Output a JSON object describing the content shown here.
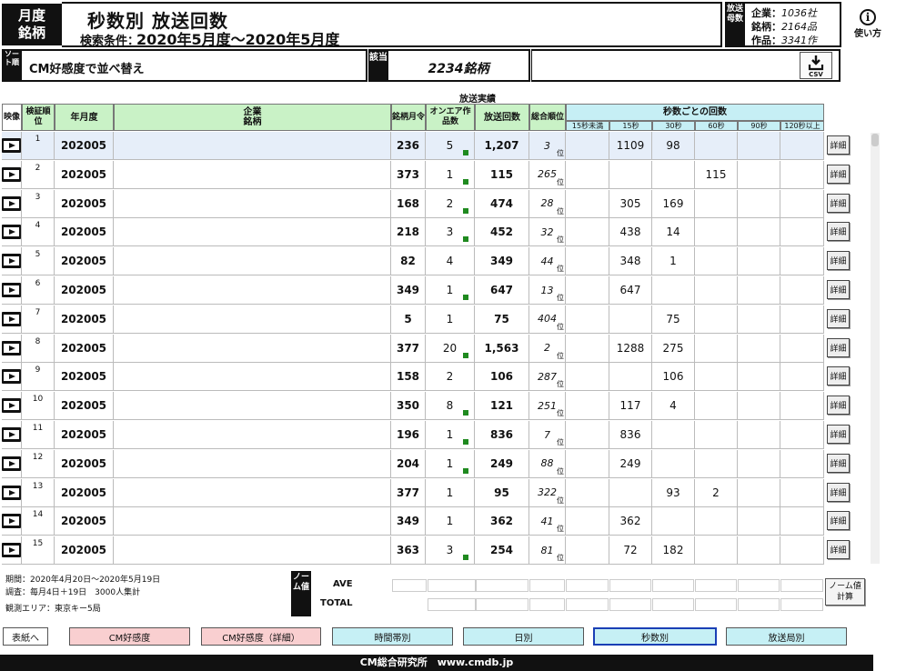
{
  "header": {
    "badge_line1": "月度",
    "badge_line2": "銘柄",
    "title": "秒数別 放送回数",
    "condition_label": "検索条件：",
    "condition_value": "2020年5月度〜2020年5月度",
    "vertical_label": "放送母数",
    "stats": [
      {
        "key": "企業：",
        "value": "1036社"
      },
      {
        "key": "銘柄：",
        "value": "2164品"
      },
      {
        "key": "作品：",
        "value": "3341作"
      }
    ],
    "help_label": "使い方",
    "help_glyph": "i"
  },
  "sort_bar": {
    "label": "ソート順",
    "value": "CM好感度で並べ替え",
    "count_label": "該当",
    "count_value": "2234銘柄",
    "csv_label": "CSV"
  },
  "table": {
    "group_label": "放送実績",
    "headers": {
      "video": "映像",
      "rank": "検証順位",
      "month": "年月度",
      "company": "企業\n銘柄",
      "brand_months": "銘柄月令",
      "onair": "オンエア作品数",
      "broadcasts": "放送回数",
      "overall_rank": "総合順位",
      "seconds_group": "秒数ごとの回数",
      "sec_cols": [
        "15秒未満",
        "15秒",
        "30秒",
        "60秒",
        "90秒",
        "120秒以上"
      ]
    },
    "detail_label": "詳細",
    "rank_suffix": "位",
    "rows": [
      {
        "rank": "1",
        "month": "202005",
        "company": "",
        "months": "236",
        "onair": "5",
        "onair_flag": true,
        "count": "1,207",
        "overall": "3",
        "sec": [
          "",
          "1109",
          "98",
          "",
          "",
          ""
        ]
      },
      {
        "rank": "2",
        "month": "202005",
        "company": "",
        "months": "373",
        "onair": "1",
        "onair_flag": true,
        "count": "115",
        "overall": "265",
        "sec": [
          "",
          "",
          "",
          "115",
          "",
          ""
        ]
      },
      {
        "rank": "3",
        "month": "202005",
        "company": "",
        "months": "168",
        "onair": "2",
        "onair_flag": true,
        "count": "474",
        "overall": "28",
        "sec": [
          "",
          "305",
          "169",
          "",
          "",
          ""
        ]
      },
      {
        "rank": "4",
        "month": "202005",
        "company": "",
        "months": "218",
        "onair": "3",
        "onair_flag": true,
        "count": "452",
        "overall": "32",
        "sec": [
          "",
          "438",
          "14",
          "",
          "",
          ""
        ]
      },
      {
        "rank": "5",
        "month": "202005",
        "company": "",
        "months": "82",
        "onair": "4",
        "onair_flag": false,
        "count": "349",
        "overall": "44",
        "sec": [
          "",
          "348",
          "1",
          "",
          "",
          ""
        ]
      },
      {
        "rank": "6",
        "month": "202005",
        "company": "",
        "months": "349",
        "onair": "1",
        "onair_flag": true,
        "count": "647",
        "overall": "13",
        "sec": [
          "",
          "647",
          "",
          "",
          "",
          ""
        ]
      },
      {
        "rank": "7",
        "month": "202005",
        "company": "",
        "months": "5",
        "onair": "1",
        "onair_flag": false,
        "count": "75",
        "overall": "404",
        "sec": [
          "",
          "",
          "75",
          "",
          "",
          ""
        ]
      },
      {
        "rank": "8",
        "month": "202005",
        "company": "",
        "months": "377",
        "onair": "20",
        "onair_flag": true,
        "count": "1,563",
        "overall": "2",
        "sec": [
          "",
          "1288",
          "275",
          "",
          "",
          ""
        ]
      },
      {
        "rank": "9",
        "month": "202005",
        "company": "",
        "months": "158",
        "onair": "2",
        "onair_flag": false,
        "count": "106",
        "overall": "287",
        "sec": [
          "",
          "",
          "106",
          "",
          "",
          ""
        ]
      },
      {
        "rank": "10",
        "month": "202005",
        "company": "",
        "months": "350",
        "onair": "8",
        "onair_flag": true,
        "count": "121",
        "overall": "251",
        "sec": [
          "",
          "117",
          "4",
          "",
          "",
          ""
        ]
      },
      {
        "rank": "11",
        "month": "202005",
        "company": "",
        "months": "196",
        "onair": "1",
        "onair_flag": true,
        "count": "836",
        "overall": "7",
        "sec": [
          "",
          "836",
          "",
          "",
          "",
          ""
        ]
      },
      {
        "rank": "12",
        "month": "202005",
        "company": "",
        "months": "204",
        "onair": "1",
        "onair_flag": true,
        "count": "249",
        "overall": "88",
        "sec": [
          "",
          "249",
          "",
          "",
          "",
          ""
        ]
      },
      {
        "rank": "13",
        "month": "202005",
        "company": "",
        "months": "377",
        "onair": "1",
        "onair_flag": false,
        "count": "95",
        "overall": "322",
        "sec": [
          "",
          "",
          "93",
          "2",
          "",
          ""
        ]
      },
      {
        "rank": "14",
        "month": "202005",
        "company": "",
        "months": "349",
        "onair": "1",
        "onair_flag": false,
        "count": "362",
        "overall": "41",
        "sec": [
          "",
          "362",
          "",
          "",
          "",
          ""
        ]
      },
      {
        "rank": "15",
        "month": "202005",
        "company": "",
        "months": "363",
        "onair": "3",
        "onair_flag": true,
        "count": "254",
        "overall": "81",
        "sec": [
          "",
          "72",
          "182",
          "",
          "",
          ""
        ]
      }
    ]
  },
  "footer": {
    "period": "期間：2020年4月20日〜2020年5月19日",
    "survey": "調査：毎月4日＋19日　3000人集計",
    "area": "観測エリア：東京キー5局",
    "norm_label": "ノーム値",
    "ave_label": "AVE",
    "total_label": "TOTAL",
    "calc_button": "ノーム値\n計算"
  },
  "nav": {
    "buttons": [
      {
        "label": "表紙へ",
        "style": "white"
      },
      {
        "label": "CM好感度",
        "style": "pink"
      },
      {
        "label": "CM好感度（詳細）",
        "style": "pink"
      },
      {
        "label": "時間帯別",
        "style": "lcyan"
      },
      {
        "label": "日別",
        "style": "lcyan"
      },
      {
        "label": "秒数別",
        "style": "lcyan",
        "selected": true
      },
      {
        "label": "放送局別",
        "style": "lcyan"
      }
    ],
    "brand": "CM総合研究所　www.cmdb.jp"
  },
  "colors": {
    "header_black": "#111111",
    "green_header": "#c9f2c6",
    "cyan_header": "#c6eff5",
    "pink_button": "#f9cfd0",
    "selected_border": "#1a3fb5",
    "onair_marker": "#1f8a1f",
    "highlight_row": "#e6eef9"
  },
  "icons": [
    "video-icon",
    "download-icon",
    "info-icon"
  ]
}
